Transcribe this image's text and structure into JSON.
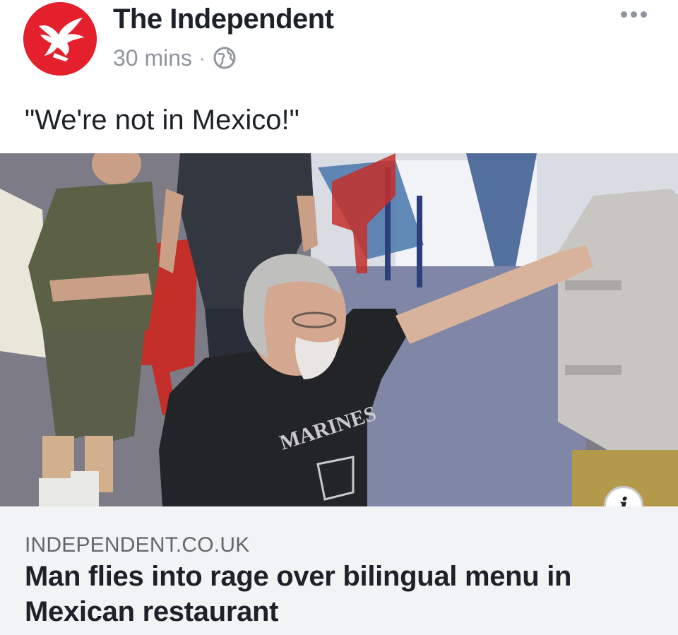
{
  "post": {
    "page_name": "The Independent",
    "time": "30 mins",
    "separator": "·",
    "privacy_icon": "globe-icon",
    "more_icon": "more-options-icon",
    "caption": "\"We're not in Mexico!\""
  },
  "photo": {
    "shirt_text": "MARINES",
    "info_icon": "info-icon",
    "info_label": "i"
  },
  "link_preview": {
    "domain": "INDEPENDENT.CO.UK",
    "headline": "Man flies into rage over bilingual menu in Mexican restaurant"
  },
  "colors": {
    "brand_red": "#e3202b",
    "text_primary": "#1d2129",
    "text_secondary": "#90949c",
    "link_bg": "#f2f3f5"
  }
}
